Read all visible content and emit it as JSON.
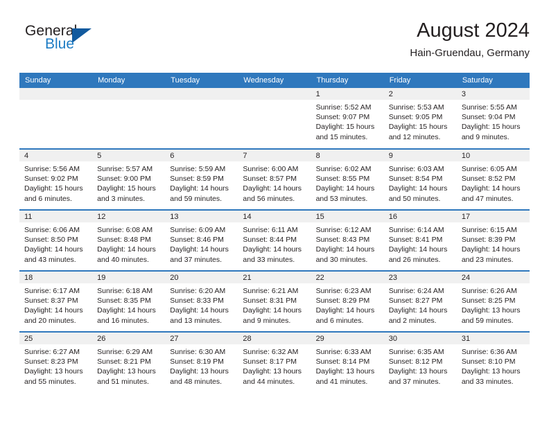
{
  "logo": {
    "line1": "General",
    "line2": "Blue",
    "triangle_color": "#125a9e",
    "blue_text_color": "#1d7cc4"
  },
  "header": {
    "title": "August 2024",
    "subtitle": "Hain-Gruendau, Germany"
  },
  "theme": {
    "header_blue": "#2f78bd",
    "daynum_strip": "#f0f0f0",
    "text": "#231f20"
  },
  "weekday_headers": [
    "Sunday",
    "Monday",
    "Tuesday",
    "Wednesday",
    "Thursday",
    "Friday",
    "Saturday"
  ],
  "weeks": [
    [
      {
        "day": "",
        "sunrise": "",
        "sunset": "",
        "daylight1": "",
        "daylight2": ""
      },
      {
        "day": "",
        "sunrise": "",
        "sunset": "",
        "daylight1": "",
        "daylight2": ""
      },
      {
        "day": "",
        "sunrise": "",
        "sunset": "",
        "daylight1": "",
        "daylight2": ""
      },
      {
        "day": "",
        "sunrise": "",
        "sunset": "",
        "daylight1": "",
        "daylight2": ""
      },
      {
        "day": "1",
        "sunrise": "Sunrise: 5:52 AM",
        "sunset": "Sunset: 9:07 PM",
        "daylight1": "Daylight: 15 hours",
        "daylight2": "and 15 minutes."
      },
      {
        "day": "2",
        "sunrise": "Sunrise: 5:53 AM",
        "sunset": "Sunset: 9:05 PM",
        "daylight1": "Daylight: 15 hours",
        "daylight2": "and 12 minutes."
      },
      {
        "day": "3",
        "sunrise": "Sunrise: 5:55 AM",
        "sunset": "Sunset: 9:04 PM",
        "daylight1": "Daylight: 15 hours",
        "daylight2": "and 9 minutes."
      }
    ],
    [
      {
        "day": "4",
        "sunrise": "Sunrise: 5:56 AM",
        "sunset": "Sunset: 9:02 PM",
        "daylight1": "Daylight: 15 hours",
        "daylight2": "and 6 minutes."
      },
      {
        "day": "5",
        "sunrise": "Sunrise: 5:57 AM",
        "sunset": "Sunset: 9:00 PM",
        "daylight1": "Daylight: 15 hours",
        "daylight2": "and 3 minutes."
      },
      {
        "day": "6",
        "sunrise": "Sunrise: 5:59 AM",
        "sunset": "Sunset: 8:59 PM",
        "daylight1": "Daylight: 14 hours",
        "daylight2": "and 59 minutes."
      },
      {
        "day": "7",
        "sunrise": "Sunrise: 6:00 AM",
        "sunset": "Sunset: 8:57 PM",
        "daylight1": "Daylight: 14 hours",
        "daylight2": "and 56 minutes."
      },
      {
        "day": "8",
        "sunrise": "Sunrise: 6:02 AM",
        "sunset": "Sunset: 8:55 PM",
        "daylight1": "Daylight: 14 hours",
        "daylight2": "and 53 minutes."
      },
      {
        "day": "9",
        "sunrise": "Sunrise: 6:03 AM",
        "sunset": "Sunset: 8:54 PM",
        "daylight1": "Daylight: 14 hours",
        "daylight2": "and 50 minutes."
      },
      {
        "day": "10",
        "sunrise": "Sunrise: 6:05 AM",
        "sunset": "Sunset: 8:52 PM",
        "daylight1": "Daylight: 14 hours",
        "daylight2": "and 47 minutes."
      }
    ],
    [
      {
        "day": "11",
        "sunrise": "Sunrise: 6:06 AM",
        "sunset": "Sunset: 8:50 PM",
        "daylight1": "Daylight: 14 hours",
        "daylight2": "and 43 minutes."
      },
      {
        "day": "12",
        "sunrise": "Sunrise: 6:08 AM",
        "sunset": "Sunset: 8:48 PM",
        "daylight1": "Daylight: 14 hours",
        "daylight2": "and 40 minutes."
      },
      {
        "day": "13",
        "sunrise": "Sunrise: 6:09 AM",
        "sunset": "Sunset: 8:46 PM",
        "daylight1": "Daylight: 14 hours",
        "daylight2": "and 37 minutes."
      },
      {
        "day": "14",
        "sunrise": "Sunrise: 6:11 AM",
        "sunset": "Sunset: 8:44 PM",
        "daylight1": "Daylight: 14 hours",
        "daylight2": "and 33 minutes."
      },
      {
        "day": "15",
        "sunrise": "Sunrise: 6:12 AM",
        "sunset": "Sunset: 8:43 PM",
        "daylight1": "Daylight: 14 hours",
        "daylight2": "and 30 minutes."
      },
      {
        "day": "16",
        "sunrise": "Sunrise: 6:14 AM",
        "sunset": "Sunset: 8:41 PM",
        "daylight1": "Daylight: 14 hours",
        "daylight2": "and 26 minutes."
      },
      {
        "day": "17",
        "sunrise": "Sunrise: 6:15 AM",
        "sunset": "Sunset: 8:39 PM",
        "daylight1": "Daylight: 14 hours",
        "daylight2": "and 23 minutes."
      }
    ],
    [
      {
        "day": "18",
        "sunrise": "Sunrise: 6:17 AM",
        "sunset": "Sunset: 8:37 PM",
        "daylight1": "Daylight: 14 hours",
        "daylight2": "and 20 minutes."
      },
      {
        "day": "19",
        "sunrise": "Sunrise: 6:18 AM",
        "sunset": "Sunset: 8:35 PM",
        "daylight1": "Daylight: 14 hours",
        "daylight2": "and 16 minutes."
      },
      {
        "day": "20",
        "sunrise": "Sunrise: 6:20 AM",
        "sunset": "Sunset: 8:33 PM",
        "daylight1": "Daylight: 14 hours",
        "daylight2": "and 13 minutes."
      },
      {
        "day": "21",
        "sunrise": "Sunrise: 6:21 AM",
        "sunset": "Sunset: 8:31 PM",
        "daylight1": "Daylight: 14 hours",
        "daylight2": "and 9 minutes."
      },
      {
        "day": "22",
        "sunrise": "Sunrise: 6:23 AM",
        "sunset": "Sunset: 8:29 PM",
        "daylight1": "Daylight: 14 hours",
        "daylight2": "and 6 minutes."
      },
      {
        "day": "23",
        "sunrise": "Sunrise: 6:24 AM",
        "sunset": "Sunset: 8:27 PM",
        "daylight1": "Daylight: 14 hours",
        "daylight2": "and 2 minutes."
      },
      {
        "day": "24",
        "sunrise": "Sunrise: 6:26 AM",
        "sunset": "Sunset: 8:25 PM",
        "daylight1": "Daylight: 13 hours",
        "daylight2": "and 59 minutes."
      }
    ],
    [
      {
        "day": "25",
        "sunrise": "Sunrise: 6:27 AM",
        "sunset": "Sunset: 8:23 PM",
        "daylight1": "Daylight: 13 hours",
        "daylight2": "and 55 minutes."
      },
      {
        "day": "26",
        "sunrise": "Sunrise: 6:29 AM",
        "sunset": "Sunset: 8:21 PM",
        "daylight1": "Daylight: 13 hours",
        "daylight2": "and 51 minutes."
      },
      {
        "day": "27",
        "sunrise": "Sunrise: 6:30 AM",
        "sunset": "Sunset: 8:19 PM",
        "daylight1": "Daylight: 13 hours",
        "daylight2": "and 48 minutes."
      },
      {
        "day": "28",
        "sunrise": "Sunrise: 6:32 AM",
        "sunset": "Sunset: 8:17 PM",
        "daylight1": "Daylight: 13 hours",
        "daylight2": "and 44 minutes."
      },
      {
        "day": "29",
        "sunrise": "Sunrise: 6:33 AM",
        "sunset": "Sunset: 8:14 PM",
        "daylight1": "Daylight: 13 hours",
        "daylight2": "and 41 minutes."
      },
      {
        "day": "30",
        "sunrise": "Sunrise: 6:35 AM",
        "sunset": "Sunset: 8:12 PM",
        "daylight1": "Daylight: 13 hours",
        "daylight2": "and 37 minutes."
      },
      {
        "day": "31",
        "sunrise": "Sunrise: 6:36 AM",
        "sunset": "Sunset: 8:10 PM",
        "daylight1": "Daylight: 13 hours",
        "daylight2": "and 33 minutes."
      }
    ]
  ]
}
